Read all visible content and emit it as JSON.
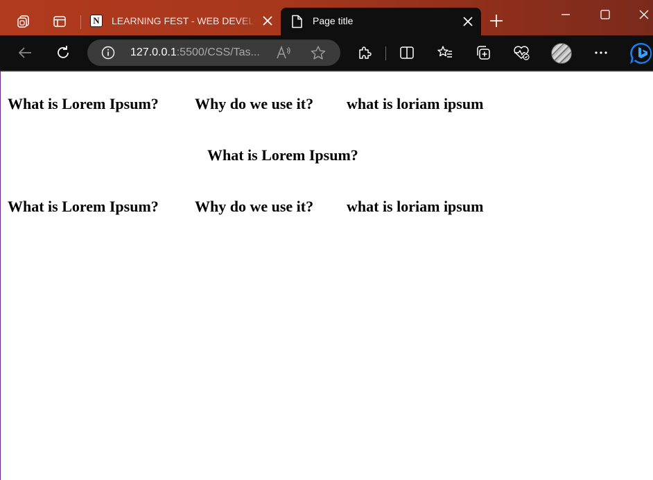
{
  "browser": {
    "tabs": [
      {
        "title": "LEARNING FEST - WEB DEVELOPMENT",
        "icon": "notion-icon",
        "active": false
      },
      {
        "title": "Page title",
        "icon": "page-icon",
        "active": true
      }
    ],
    "address_bar": {
      "host": "127.0.0.1",
      "rest": ":5500/CSS/Tas..."
    },
    "colors": {
      "titlebar": "#a8381c",
      "toolbar": "#0f0f0f",
      "bing_blue": "#1a7ef2"
    }
  },
  "page": {
    "row1": [
      "What is Lorem Ipsum?",
      "Why do we use it?",
      "what is loriam ipsum"
    ],
    "centered": "What is Lorem Ipsum?",
    "row2": [
      "What is Lorem Ipsum?",
      "Why do we use it?",
      "what is loriam ipsum"
    ]
  }
}
